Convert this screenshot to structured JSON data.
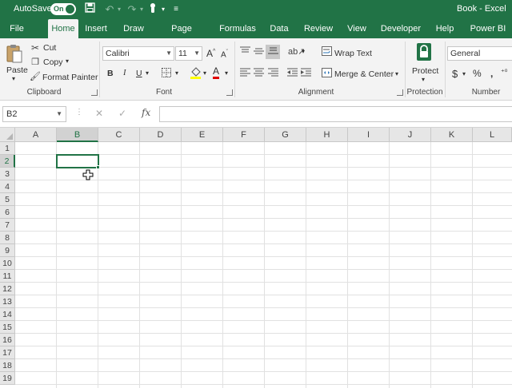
{
  "titlebar": {
    "autosave_label": "AutoSave",
    "autosave_state": "On",
    "document_title": "Book - Excel"
  },
  "tabs": [
    "File",
    "Home",
    "Insert",
    "Draw",
    "Page Layout",
    "Formulas",
    "Data",
    "Review",
    "View",
    "Developer",
    "Help",
    "Power BI"
  ],
  "active_tab": "Home",
  "ribbon": {
    "clipboard": {
      "label": "Clipboard",
      "paste": "Paste",
      "cut": "Cut",
      "copy": "Copy",
      "format_painter": "Format Painter"
    },
    "font": {
      "label": "Font",
      "font_name": "Calibri",
      "font_size": "11",
      "bold": "B",
      "italic": "I",
      "underline": "U",
      "grow": "A",
      "shrink": "A",
      "font_color": "A"
    },
    "alignment": {
      "label": "Alignment",
      "wrap_text": "Wrap Text",
      "merge_center": "Merge & Center"
    },
    "protection": {
      "label": "Protection",
      "protect": "Protect"
    },
    "number": {
      "label": "Number",
      "format": "General",
      "currency": "$",
      "percent": "%"
    }
  },
  "formula_bar": {
    "name_box": "B2",
    "cancel": "✕",
    "enter": "✓",
    "fx": "fx",
    "formula": ""
  },
  "sheet": {
    "columns": [
      "A",
      "B",
      "C",
      "D",
      "E",
      "F",
      "G",
      "H",
      "I",
      "J",
      "K",
      "L"
    ],
    "rows": [
      "1",
      "2",
      "3",
      "4",
      "5",
      "6",
      "7",
      "8",
      "9",
      "10",
      "11",
      "12",
      "13",
      "14",
      "15",
      "16",
      "17",
      "18",
      "19"
    ],
    "selected_cell": "B2"
  },
  "colors": {
    "brand": "#217346",
    "ribbon_bg": "#f3f3f3",
    "header_bg": "#e6e6e6",
    "grid_line": "#e1e1e1"
  }
}
